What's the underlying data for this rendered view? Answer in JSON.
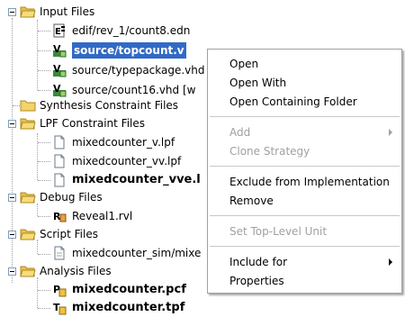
{
  "tree": {
    "input_files": {
      "label": "Input Files",
      "items": [
        {
          "label": "edif/rev_1/count8.edn",
          "icon": "edif-file-icon"
        },
        {
          "label": "source/topcount.v",
          "icon": "verilog-file-icon",
          "selected": true
        },
        {
          "label": "source/typepackage.vhd",
          "icon": "vhdl-file-icon"
        },
        {
          "label": "source/count16.vhd [w",
          "icon": "vhdl-file-icon"
        }
      ]
    },
    "synthesis": {
      "label": "Synthesis Constraint Files"
    },
    "lpf": {
      "label": "LPF Constraint Files",
      "items": [
        {
          "label": "mixedcounter_v.lpf"
        },
        {
          "label": "mixedcounter_vv.lpf"
        },
        {
          "label": "mixedcounter_vve.l",
          "bold": true
        }
      ]
    },
    "debug": {
      "label": "Debug Files",
      "items": [
        {
          "label": "Reveal1.rvl"
        }
      ]
    },
    "script": {
      "label": "Script Files",
      "items": [
        {
          "label": "mixedcounter_sim/mixe"
        }
      ]
    },
    "analysis": {
      "label": "Analysis Files",
      "items": [
        {
          "label": "mixedcounter.pcf",
          "bold": true
        },
        {
          "label": "mixedcounter.tpf",
          "bold": true
        }
      ]
    }
  },
  "context_menu": {
    "open": "Open",
    "open_with": "Open With",
    "open_containing_folder": "Open Containing Folder",
    "add": "Add",
    "clone_strategy": "Clone Strategy",
    "exclude": "Exclude from Implementation",
    "remove": "Remove",
    "set_top_level": "Set Top-Level Unit",
    "include_for": "Include for",
    "properties": "Properties"
  },
  "colors": {
    "selection": "#316ac5",
    "folder": "#f2d46a",
    "disabled_text": "#a0a0a0"
  }
}
